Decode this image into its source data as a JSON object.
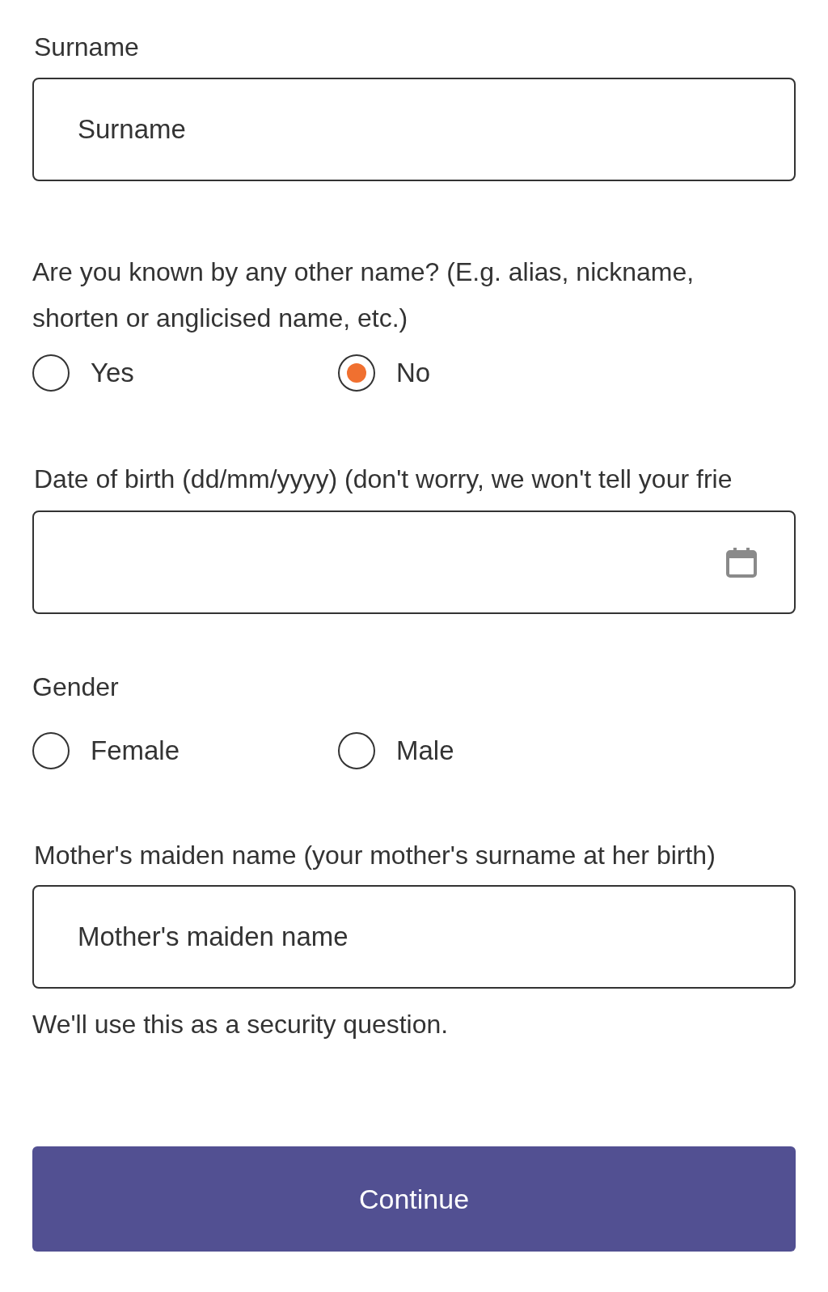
{
  "surname": {
    "label": "Surname",
    "placeholder": "Surname"
  },
  "other_name": {
    "question": "Are you known by any other name? (E.g. alias, nickname, shorten or anglicised name, etc.)",
    "options": [
      {
        "label": "Yes",
        "selected": false
      },
      {
        "label": "No",
        "selected": true
      }
    ]
  },
  "date_of_birth": {
    "label": "Date of birth (dd/mm/yyyy) (don't worry, we won't tell your frie"
  },
  "gender": {
    "label": "Gender",
    "options": [
      {
        "label": "Female",
        "selected": false
      },
      {
        "label": "Male",
        "selected": false
      }
    ]
  },
  "maiden_name": {
    "label": "Mother's maiden name (your mother's surname at her birth)",
    "placeholder": "Mother's maiden name",
    "help": "We'll use this as a security question."
  },
  "button": "Continue"
}
